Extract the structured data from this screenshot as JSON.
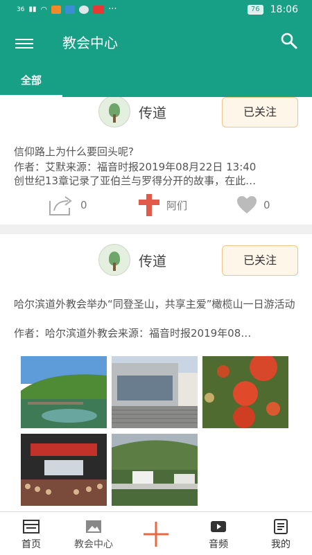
{
  "status_bar": {
    "network": "36",
    "battery": "76",
    "time": "18:06"
  },
  "app_bar": {
    "title": "教会中心",
    "menu_icon": "menu-icon",
    "search_icon": "search-icon",
    "tab_all": "全部"
  },
  "colors": {
    "primary": "#17a086",
    "follow_border": "#f2c48a",
    "accent_red": "#e25a4a"
  },
  "posts": [
    {
      "author": "传道",
      "follow_label": "已关注",
      "title": "信仰路上为什么要回头呢?",
      "meta": "作者：艾默来源：福音时报2019年08月22日 13:40",
      "excerpt": "创世纪13章记录了亚伯兰与罗得分开的故事，在此…",
      "share_count": "0",
      "amen_label": "阿们",
      "like_count": "0"
    },
    {
      "author": "传道",
      "follow_label": "已关注",
      "title": "哈尔滨道外教会举办“同登圣山，共享主爱”橄榄山一日游活动",
      "meta": "作者：哈尔滨道外教会来源：福音时报2019年08…",
      "images": [
        "lake-scene",
        "church-building",
        "tomatoes",
        "auditorium",
        "hillside-buildings"
      ]
    }
  ],
  "bottom_nav": {
    "home": "首页",
    "church": "教会中心",
    "audio": "音频",
    "mine": "我的"
  }
}
